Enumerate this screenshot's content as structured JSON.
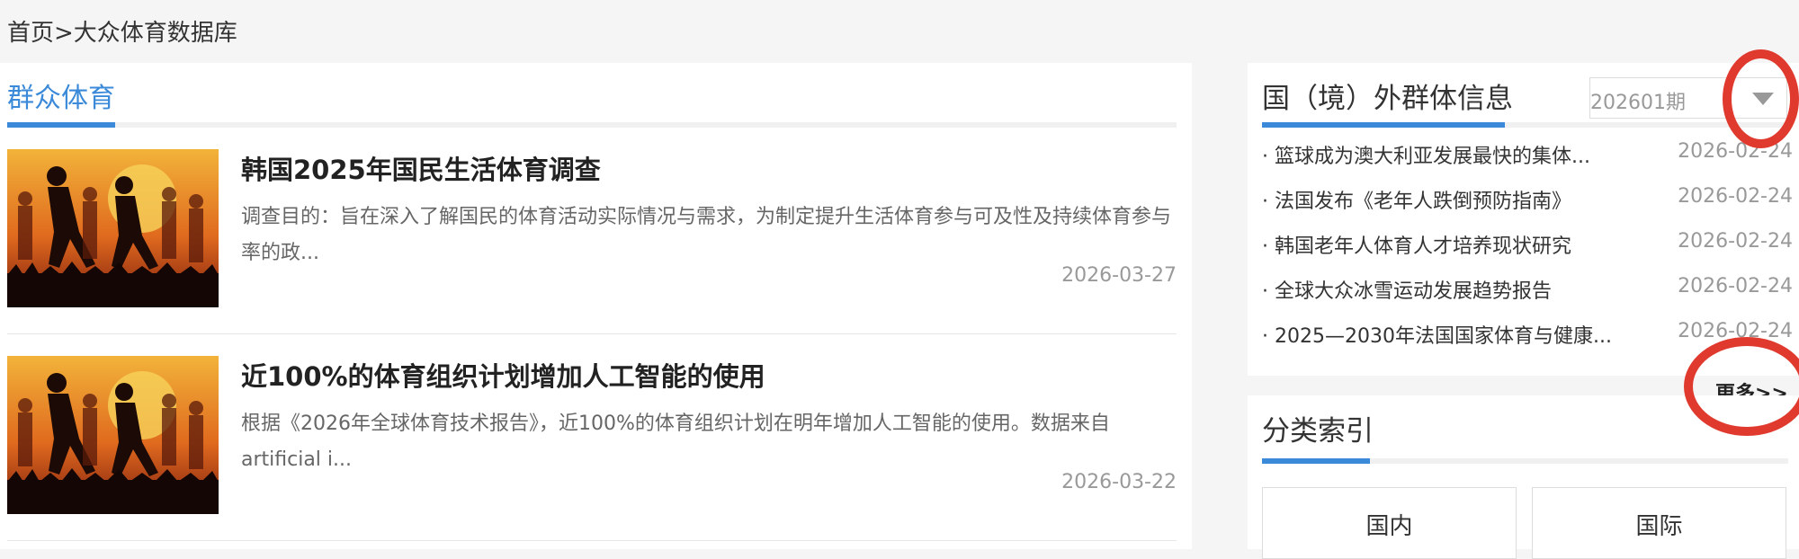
{
  "breadcrumb": "首页>大众体育数据库",
  "main": {
    "section_title": "群众体育",
    "articles": [
      {
        "title": "韩国2025年国民生活体育调查",
        "summary": "调查目的：旨在深入了解国民的体育活动实际情况与需求，为制定提升生活体育参与可及性及持续体育参与率的政...",
        "date": "2026-03-27"
      },
      {
        "title": "近100%的体育组织计划增加人工智能的使用",
        "summary": "根据《2026年全球体育技术报告》，近100%的体育组织计划在明年增加人工智能的使用。数据来自artificial i...",
        "date": "2026-03-22"
      }
    ]
  },
  "sidebar": {
    "foreign": {
      "title": "国（境）外群体信息",
      "issue_value": "202601期",
      "items": [
        {
          "title": "· 篮球成为澳大利亚发展最快的集体...",
          "date": "2026-02-24"
        },
        {
          "title": "· 法国发布《老年人跌倒预防指南》",
          "date": "2026-02-24"
        },
        {
          "title": "· 韩国老年人体育人才培养现状研究",
          "date": "2026-02-24"
        },
        {
          "title": "· 全球大众冰雪运动发展趋势报告",
          "date": "2026-02-24"
        },
        {
          "title": "· 2025—2030年法国国家体育与健康...",
          "date": "2026-02-24"
        }
      ],
      "more_label": "更多>>"
    },
    "category": {
      "title": "分类索引",
      "buttons": [
        "国内",
        "国际"
      ]
    }
  },
  "colors": {
    "accent": "#3b8ad9",
    "annotation": "#e03a2f"
  }
}
